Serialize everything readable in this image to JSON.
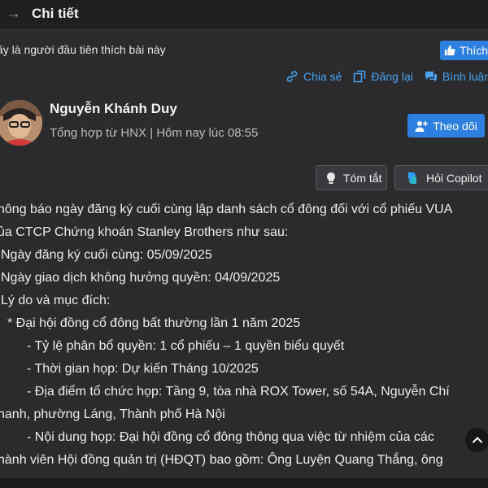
{
  "header": {
    "back_icon": "arrow-right-icon",
    "title": "Chi tiết"
  },
  "like_bar": {
    "text": "ãy là người đầu tiên thích bài này",
    "button_label": "Thích"
  },
  "actions": [
    {
      "label": "Chia sẻ",
      "icon": "link-icon"
    },
    {
      "label": "Đăng lại",
      "icon": "repost-icon"
    },
    {
      "label": "Bình luận",
      "icon": "comment-icon"
    }
  ],
  "author": {
    "name": "Nguyễn Khánh Duy",
    "meta": "Tổng hợp từ HNX | Hôm nay lúc 08:55",
    "follow_label": "Theo dõi"
  },
  "tools": {
    "summary_label": "Tóm tắt",
    "copilot_label": "Hỏi Copilot"
  },
  "content": {
    "lines": [
      "hông báo ngày đăng ký cuối cùng lập danh sách cổ đông đối với cổ phiếu VUA",
      "ủa CTCP Chứng khoán Stanley Brothers như sau:",
      " Ngày đăng ký cuối cùng: 05/09/2025",
      " Ngày giao dịch không hưởng quyền: 04/09/2025",
      " Lý do và mục đích:",
      "* Đại hội đồng cổ đông bất thường lần 1 năm 2025",
      "- Tỷ lệ phân bổ quyền: 1 cổ phiếu – 1 quyền biểu quyết",
      "- Thời gian họp: Dự kiến Tháng 10/2025",
      "- Địa điểm tổ chức họp: Tầng 9, tòa nhà ROX Tower, số 54A, Nguyễn Chí",
      "hanh, phường Láng, Thành phố Hà Nội",
      "- Nội dung họp: Đại hội đồng cổ đông thông qua việc từ nhiệm của các",
      "hành viên Hội đồng quản trị (HĐQT) bao gồm: Ông Luyện Quang Thắng, ông"
    ]
  },
  "scroll_top_icon": "chevron-up-icon"
}
